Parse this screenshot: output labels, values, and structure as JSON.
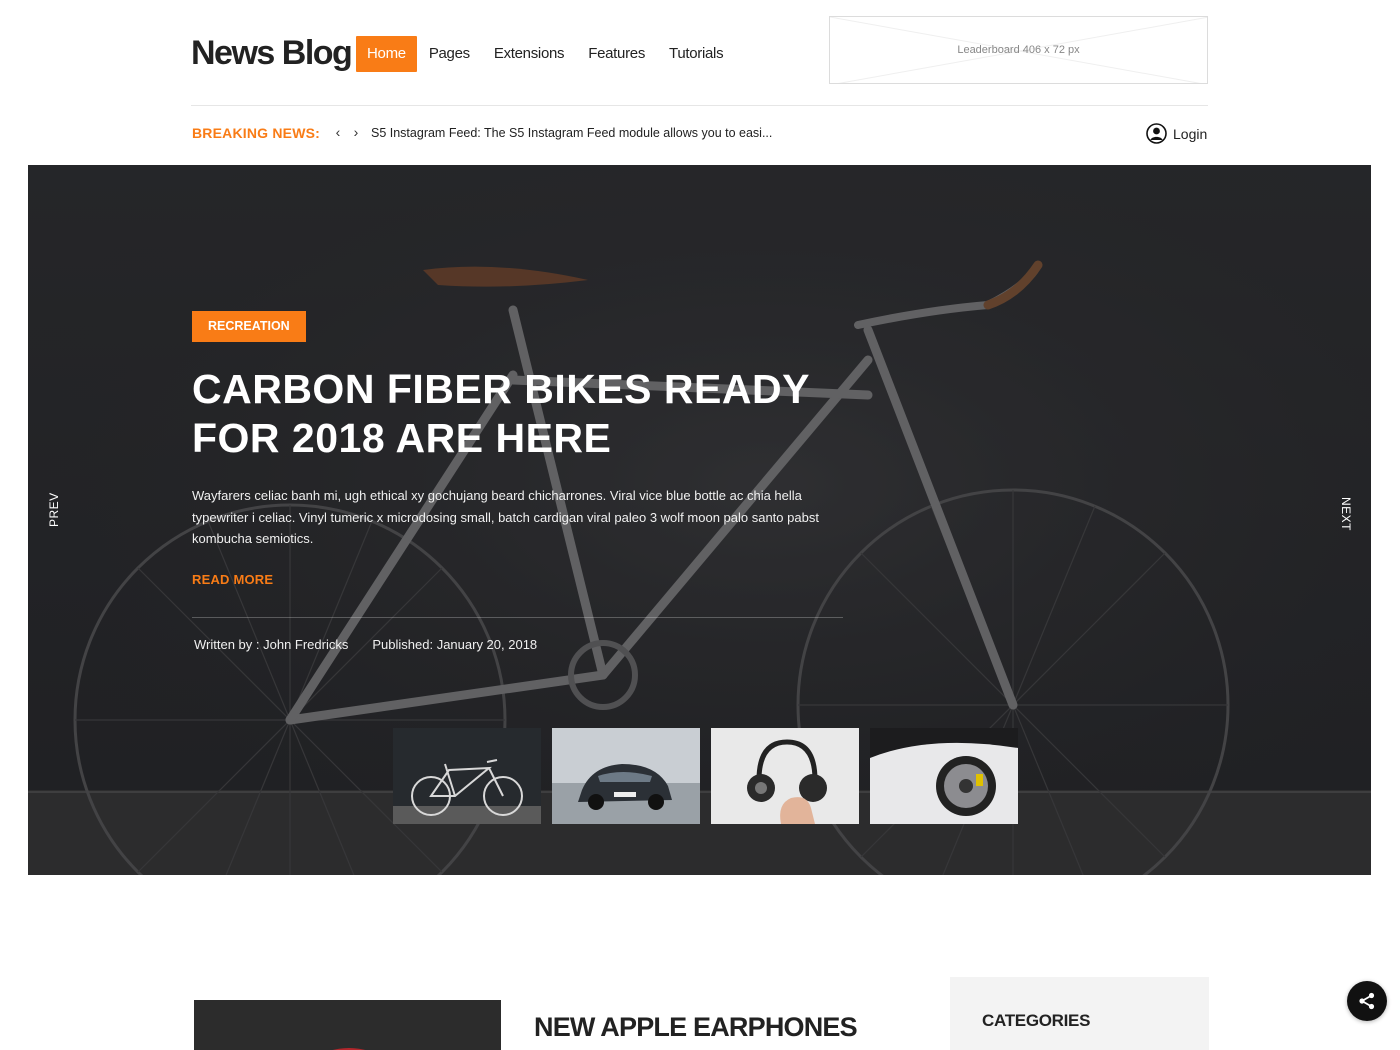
{
  "header": {
    "logo": "News Blog",
    "nav": [
      {
        "label": "Home",
        "active": true
      },
      {
        "label": "Pages",
        "active": false
      },
      {
        "label": "Extensions",
        "active": false
      },
      {
        "label": "Features",
        "active": false
      },
      {
        "label": "Tutorials",
        "active": false
      }
    ],
    "leaderboard_text": "Leaderboard  406 x 72 px"
  },
  "breaking": {
    "label": "BREAKING NEWS:",
    "prev_glyph": "‹",
    "next_glyph": "›",
    "text": "S5 Instagram Feed: The S5 Instagram Feed module allows you to easi..."
  },
  "login": {
    "label": "Login",
    "icon": "user-icon"
  },
  "hero": {
    "category": "RECREATION",
    "title_line1": "CARBON FIBER BIKES READY",
    "title_line2": "FOR 2018 ARE HERE",
    "excerpt": "Wayfarers celiac banh mi, ugh ethical xy gochujang beard chicharrones. Viral vice blue bottle ac chia hella typewriter i celiac. Vinyl tumeric x microdosing small, batch cardigan viral paleo 3 wolf moon palo santo pabst kombucha semiotics.",
    "read_more": "READ MORE",
    "author": "Written by : John Fredricks",
    "published": "Published: January 20, 2018",
    "prev_label": "PREV",
    "next_label": "NEXT",
    "thumbnails": [
      "bicycle",
      "car",
      "headphones",
      "sports-car"
    ]
  },
  "post": {
    "title": "NEW APPLE EARPHONES"
  },
  "sidebar": {
    "title": "CATEGORIES"
  },
  "colors": {
    "accent": "#f97c16",
    "hero_bg": "#2e2e30",
    "text": "#222222"
  }
}
